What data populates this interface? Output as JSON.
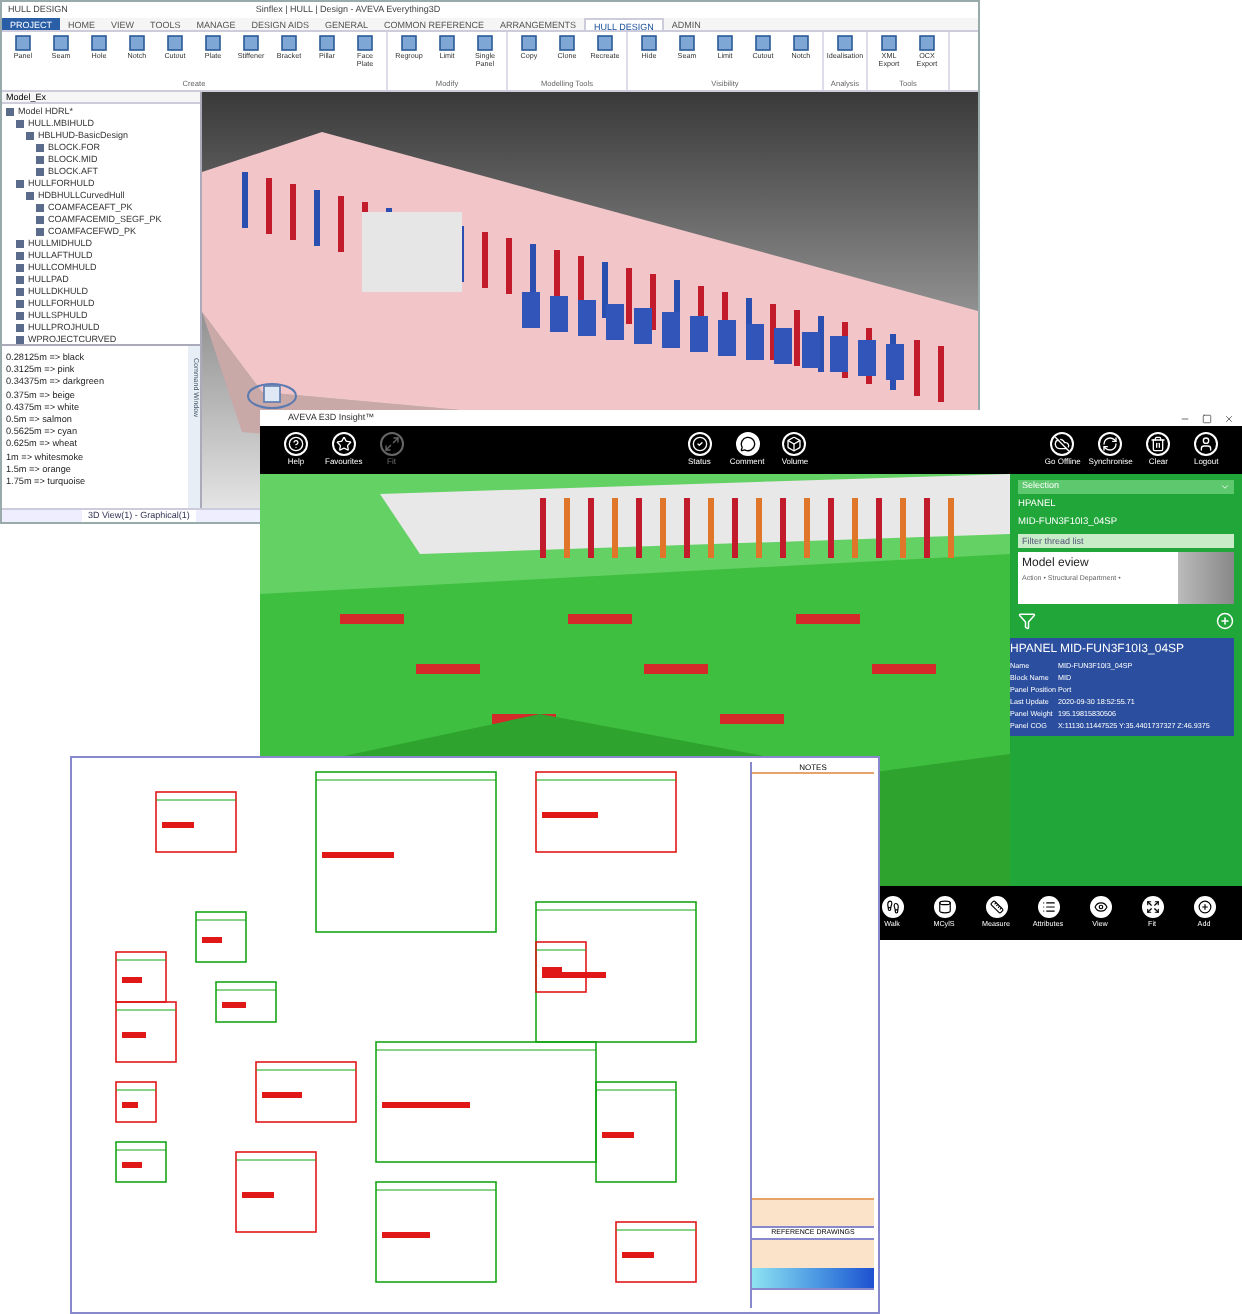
{
  "cad_window": {
    "quick_access": "HULL DESIGN",
    "title": "Sinflex | HULL | Design - AVEVA Everything3D",
    "ribbon_tabs": [
      {
        "label": "PROJECT",
        "selected": false
      },
      {
        "label": "HOME",
        "selected": false
      },
      {
        "label": "VIEW",
        "selected": false
      },
      {
        "label": "TOOLS",
        "selected": false
      },
      {
        "label": "MANAGE",
        "selected": false
      },
      {
        "label": "DESIGN AIDS",
        "selected": false
      },
      {
        "label": "GENERAL",
        "selected": false
      },
      {
        "label": "COMMON REFERENCE",
        "selected": false
      },
      {
        "label": "ARRANGEMENTS",
        "selected": false
      },
      {
        "label": "HULL DESIGN",
        "selected": true
      },
      {
        "label": "ADMIN",
        "selected": false
      }
    ],
    "ribbon_groups": [
      {
        "label": "Create",
        "buttons": [
          "Panel",
          "Seam",
          "Hole",
          "Notch",
          "Cutout",
          "Plate",
          "Stiffener",
          "Bracket",
          "Pillar",
          "Face Plate"
        ]
      },
      {
        "label": "Modify",
        "buttons": [
          "Regroup",
          "Limit",
          "Single Panel"
        ]
      },
      {
        "label": "Modelling Tools",
        "buttons": [
          "Copy",
          "Clone",
          "Recreate"
        ]
      },
      {
        "label": "Visibility",
        "buttons": [
          "Hide",
          "Seam",
          "Limit",
          "Cutout",
          "Notch"
        ]
      },
      {
        "label": "Analysis",
        "buttons": [
          "Idealisation"
        ]
      },
      {
        "label": "Tools",
        "buttons": [
          "XML Export",
          "OCX Export"
        ]
      }
    ],
    "tree_search": "Model_Ex",
    "tree": [
      {
        "label": "Model HDRL*",
        "children": [
          {
            "label": "HULL.MBIHULD",
            "children": [
              {
                "label": "HBLHUD-BasicDesign",
                "children": [
                  {
                    "label": "BLOCK.FOR"
                  },
                  {
                    "label": "BLOCK.MID"
                  },
                  {
                    "label": "BLOCK.AFT"
                  }
                ]
              }
            ]
          },
          {
            "label": "HULLFORHULD",
            "children": [
              {
                "label": "HDBHULLCurvedHull",
                "children": [
                  {
                    "label": "COAMFACEAFT_PK"
                  },
                  {
                    "label": "COAMFACEMID_SEGF_PK"
                  },
                  {
                    "label": "COAMFACEFWD_PK"
                  }
                ]
              }
            ]
          },
          {
            "label": "HULLMIDHULD"
          },
          {
            "label": "HULLAFTHULD"
          },
          {
            "label": "HULLCOMHULD"
          },
          {
            "label": "HULLPAD"
          },
          {
            "label": "HULLDKHULD"
          },
          {
            "label": "HULLFORHULD"
          },
          {
            "label": "HULLSPHULD"
          },
          {
            "label": "HULLPROJHULD"
          },
          {
            "label": "WPROJECTCURVED"
          }
        ]
      }
    ],
    "command_window_label": "Command Window",
    "legend": [
      "0.28125m => black",
      "0.3125m => pink",
      "0.34375m => darkgreen",
      "0.375m => beige",
      "0.4375m => white",
      "0.5m => salmon",
      "0.5625m => cyan",
      "0.625m => wheat",
      "1m => whitesmoke",
      "1.5m => orange",
      "1.75m => turquoise"
    ],
    "view_tab": "3D View(1) - Graphical(1)"
  },
  "insight_window": {
    "title": "AVEVA E3D Insight™",
    "toolbar": [
      {
        "label": "Help",
        "disabled": false,
        "selected": false
      },
      {
        "label": "Favourites",
        "disabled": false,
        "selected": false
      },
      {
        "label": "Fit",
        "disabled": true,
        "selected": false
      },
      {
        "label": "Status",
        "disabled": false,
        "selected": false
      },
      {
        "label": "Comment",
        "disabled": false,
        "selected": true
      },
      {
        "label": "Volume",
        "disabled": false,
        "selected": false
      },
      {
        "label": "Go Offline",
        "disabled": false,
        "selected": false
      },
      {
        "label": "Synchronise",
        "disabled": false,
        "selected": false
      },
      {
        "label": "Clear",
        "disabled": false,
        "selected": false
      },
      {
        "label": "Logout",
        "disabled": false,
        "selected": false
      }
    ],
    "panel": {
      "dropdown": "Selection",
      "type": "HPANEL",
      "name": "MID-FUN3F10I3_04SP",
      "filter_placeholder": "Filter thread list",
      "card_title": "Model eview",
      "card_text": "Action • Structural Department •"
    },
    "info": {
      "title": "HPANEL MID-FUN3F10I3_04SP",
      "rows": [
        {
          "label": "Name",
          "value": "MID-FUN3F10I3_04SP"
        },
        {
          "label": "Block Name",
          "value": "MID"
        },
        {
          "label": "Panel Position",
          "value": "Port"
        },
        {
          "label": "Last Update",
          "value": "2020-09-30 18:52:55.71"
        },
        {
          "label": "Panel Weight",
          "value": "195.19815830506"
        },
        {
          "label": "Panel COG",
          "value": "X:11130.11447525 Y:35.4401737327 Z:46.9375"
        }
      ]
    },
    "bottom_toolbar": [
      "Walk",
      "MCylS",
      "Measure",
      "Attributes",
      "View",
      "Fit",
      "Add"
    ]
  },
  "drawing_sheet": {
    "notes_title": "NOTES",
    "references_title": "REFERENCE DRAWINGS"
  }
}
